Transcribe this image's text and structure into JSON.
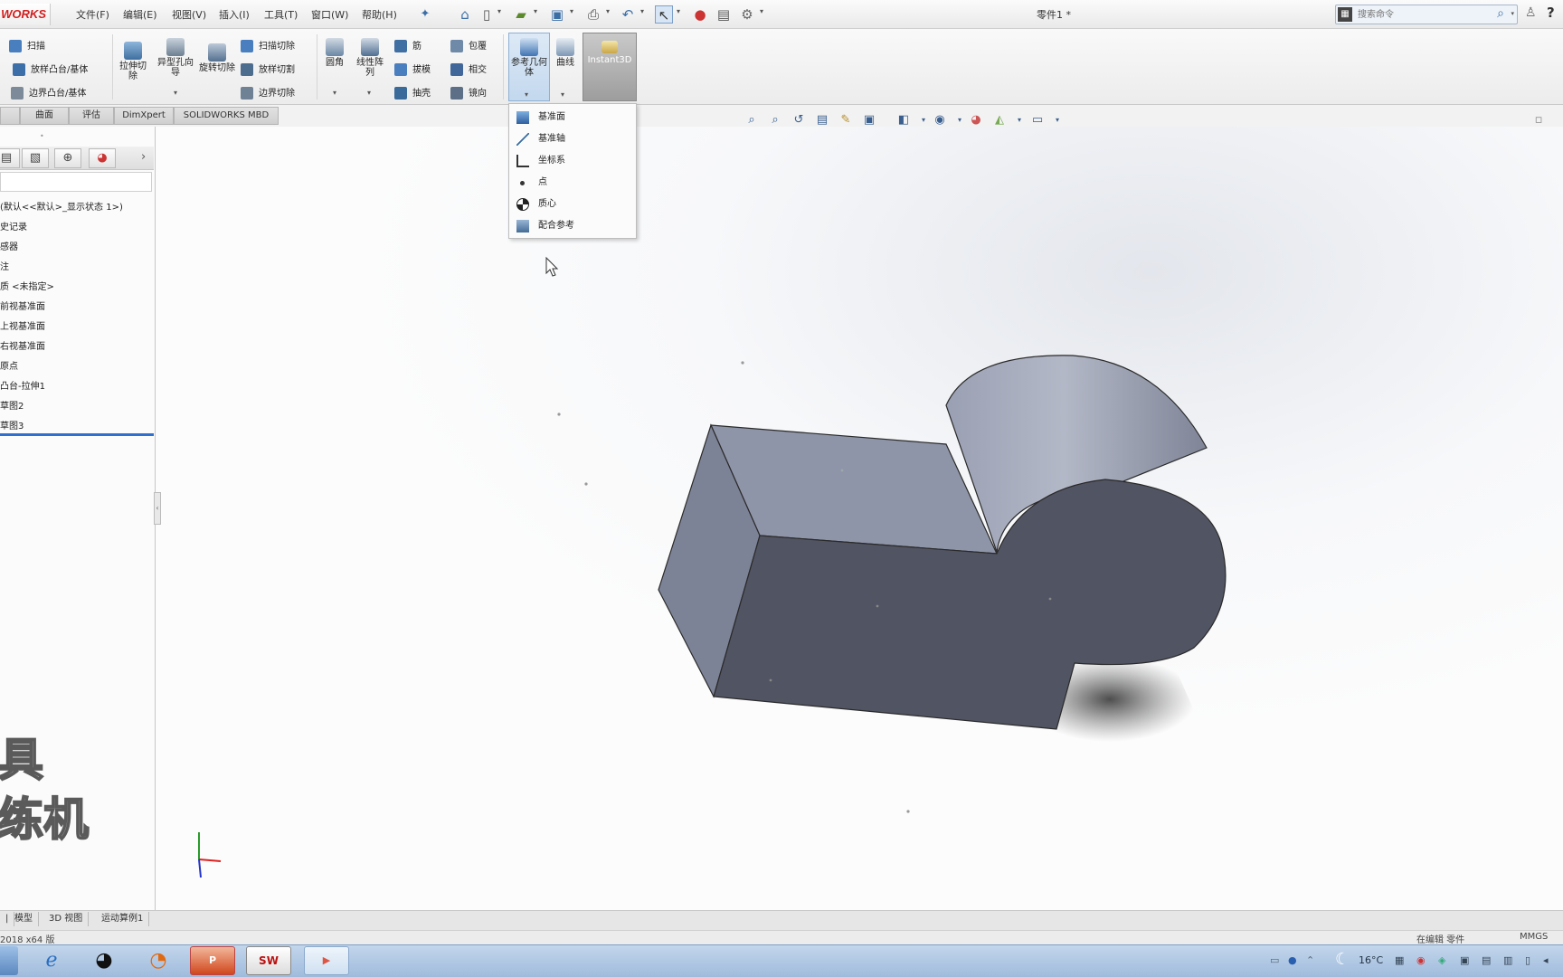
{
  "app": {
    "logo_text": "WORKS",
    "document_title": "零件1 *"
  },
  "menu": [
    "文件(F)",
    "编辑(E)",
    "视图(V)",
    "插入(I)",
    "工具(T)",
    "窗口(W)",
    "帮助(H)"
  ],
  "search": {
    "placeholder": "搜索命令"
  },
  "ribbon": {
    "col1": [
      "扫描",
      "放样凸台/基体",
      "边界凸台/基体"
    ],
    "big1": "拉伸切除",
    "big2": "异型孔向导",
    "big3": "旋转切除",
    "col2": [
      "扫描切除",
      "放样切割",
      "边界切除"
    ],
    "big4": "圆角",
    "big5": "线性阵列",
    "col3": [
      "筋",
      "拔模",
      "抽壳"
    ],
    "col4": [
      "包覆",
      "相交",
      "镜向"
    ],
    "refgeo": "参考几何体",
    "curves": "曲线",
    "instant3d": "Instant3D"
  },
  "tabs": [
    "曲面",
    "评估",
    "DimXpert",
    "SOLIDWORKS MBD"
  ],
  "refgeo_menu": [
    "基准面",
    "基准轴",
    "坐标系",
    "点",
    "质心",
    "配合参考"
  ],
  "tree": [
    "(默认<<默认>_显示状态 1>)",
    "史记录",
    "感器",
    "注",
    "质 <未指定>",
    "前视基准面",
    "上视基准面",
    "右视基准面",
    "原点",
    "凸台-拉伸1",
    "草图2",
    "草图3"
  ],
  "overlay": {
    "line1": "具",
    "line2": "练机"
  },
  "bottom_tabs": [
    "模型",
    "3D 视图",
    "运动算例1"
  ],
  "status": {
    "left": "2018 x64 版",
    "mid": "在编辑 零件",
    "right": "MMGS"
  },
  "tray": {
    "temp": "16°C"
  }
}
